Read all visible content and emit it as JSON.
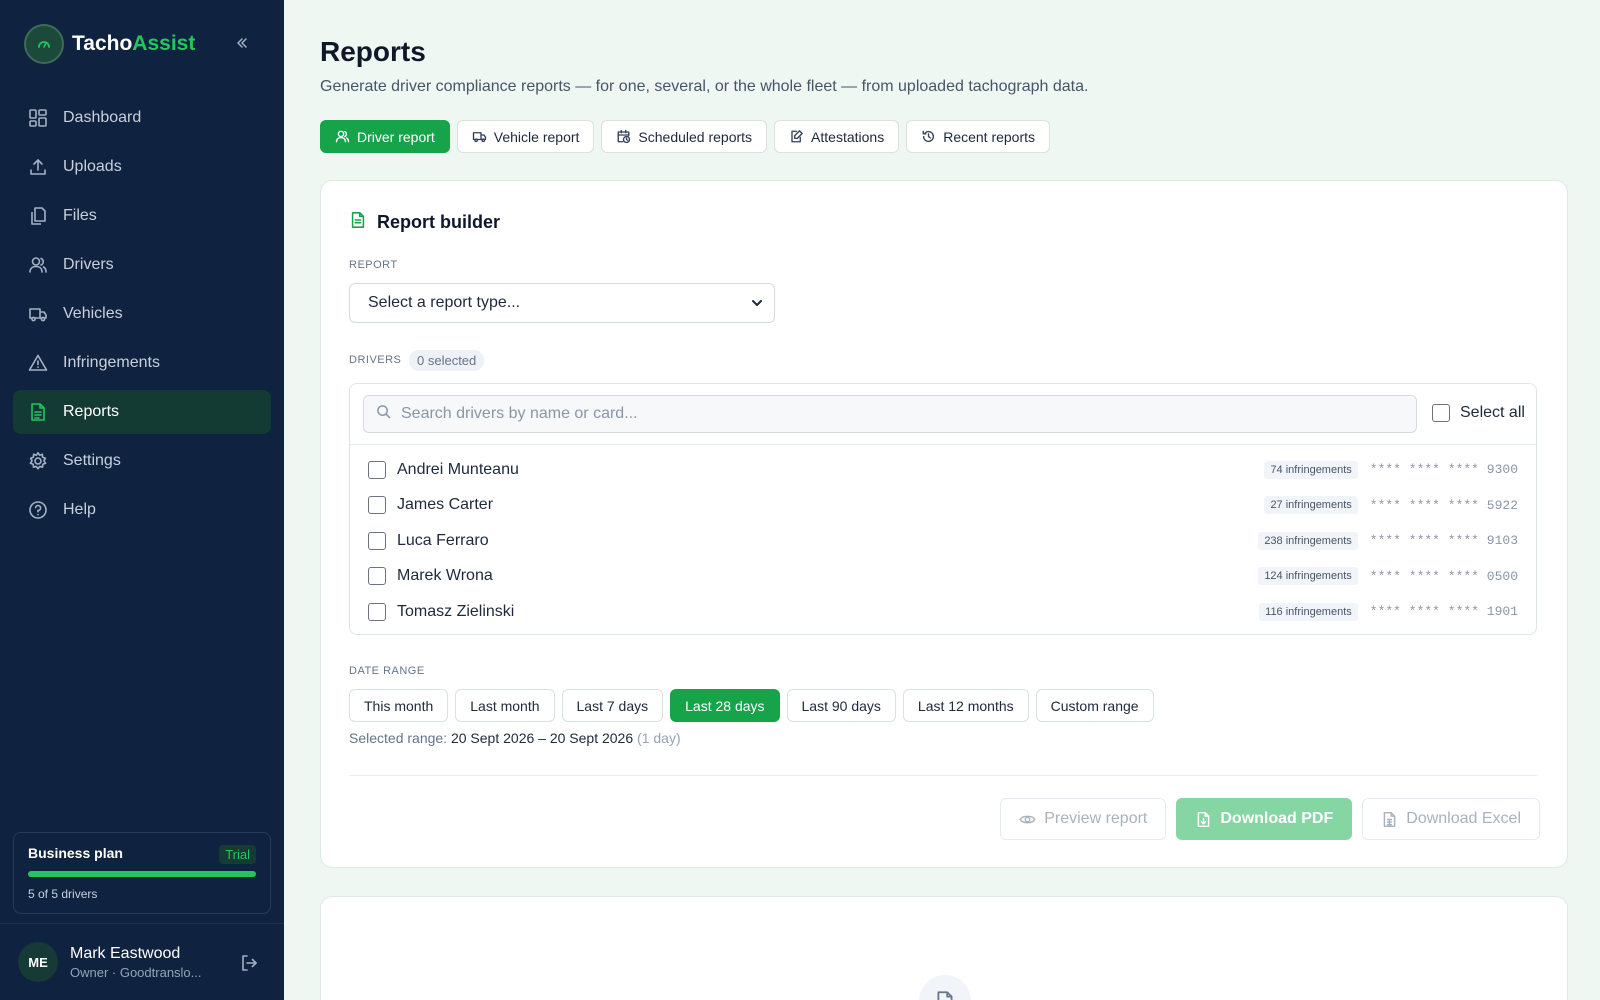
{
  "brand": {
    "name_part1": "Tacho",
    "name_part2": "Assist"
  },
  "sidebar": {
    "items": [
      {
        "label": "Dashboard",
        "icon": "dashboard-icon"
      },
      {
        "label": "Uploads",
        "icon": "upload-icon"
      },
      {
        "label": "Files",
        "icon": "files-icon"
      },
      {
        "label": "Drivers",
        "icon": "users-icon"
      },
      {
        "label": "Vehicles",
        "icon": "truck-icon"
      },
      {
        "label": "Infringements",
        "icon": "warning-icon"
      },
      {
        "label": "Reports",
        "icon": "report-icon",
        "active": true
      },
      {
        "label": "Settings",
        "icon": "gear-icon"
      },
      {
        "label": "Help",
        "icon": "help-icon"
      }
    ],
    "plan": {
      "title": "Business plan",
      "badge": "Trial",
      "usage": "5 of 5 drivers",
      "fill_fraction": 1.0
    },
    "user": {
      "initials": "ME",
      "name": "Mark Eastwood",
      "role": "Owner · Goodtranslo..."
    }
  },
  "page": {
    "title": "Reports",
    "subtitle": "Generate driver compliance reports — for one, several, or the whole fleet — from uploaded tachograph data."
  },
  "tabs": [
    {
      "label": "Driver report",
      "icon": "users-icon",
      "active": true
    },
    {
      "label": "Vehicle report",
      "icon": "truck-icon"
    },
    {
      "label": "Scheduled reports",
      "icon": "calendar-clock-icon"
    },
    {
      "label": "Attestations",
      "icon": "edit-document-icon"
    },
    {
      "label": "Recent reports",
      "icon": "history-icon"
    }
  ],
  "builder": {
    "title": "Report builder",
    "report_label": "REPORT",
    "report_select_value": "Select a report type...",
    "drivers_label": "DRIVERS",
    "drivers_selected": "0 selected",
    "search_placeholder": "Search drivers by name or card...",
    "select_all_label": "Select all",
    "drivers": [
      {
        "name": "Andrei Munteanu",
        "infringements": "74 infringements",
        "card": "**** **** **** 9300"
      },
      {
        "name": "James Carter",
        "infringements": "27 infringements",
        "card": "**** **** **** 5922"
      },
      {
        "name": "Luca Ferraro",
        "infringements": "238 infringements",
        "card": "**** **** **** 9103"
      },
      {
        "name": "Marek Wrona",
        "infringements": "124 infringements",
        "card": "**** **** **** 0500"
      },
      {
        "name": "Tomasz Zielinski",
        "infringements": "116 infringements",
        "card": "**** **** **** 1901"
      }
    ],
    "date_range_label": "DATE RANGE",
    "ranges": [
      {
        "label": "This month"
      },
      {
        "label": "Last month"
      },
      {
        "label": "Last 7 days"
      },
      {
        "label": "Last 28 days",
        "active": true
      },
      {
        "label": "Last 90 days"
      },
      {
        "label": "Last 12 months"
      },
      {
        "label": "Custom range"
      }
    ],
    "selected_range_prefix": "Selected range:",
    "selected_range_value": "20 Sept 2026 – 20 Sept 2026",
    "selected_range_days": "(1 day)",
    "actions": {
      "preview": "Preview report",
      "pdf": "Download PDF",
      "excel": "Download Excel"
    }
  },
  "colors": {
    "accent": "#16a34a",
    "sidebar_bg": "#0f2340",
    "page_bg": "#eef7f1"
  }
}
